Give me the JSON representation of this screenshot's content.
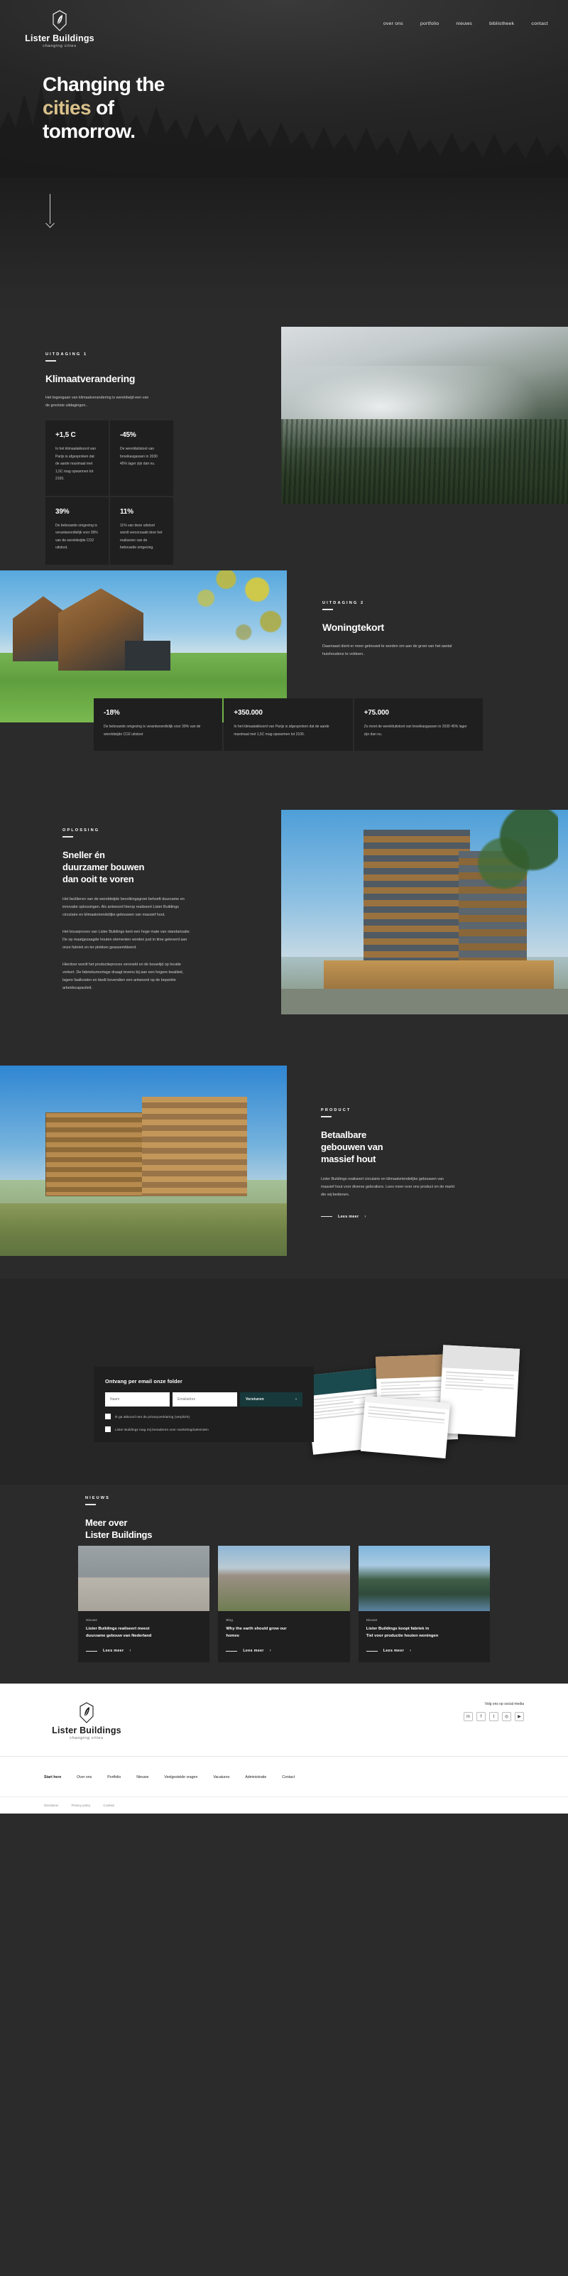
{
  "brand": {
    "name": "Lister Buildings",
    "tagline": "changing cities",
    "logo_icon": "leaf-shield-logo-icon"
  },
  "nav": {
    "items": [
      {
        "label": "over ons"
      },
      {
        "label": "portfolio"
      },
      {
        "label": "nieuws"
      },
      {
        "label": "bibliotheek"
      },
      {
        "label": "contact"
      }
    ]
  },
  "hero": {
    "line1": "Changing the",
    "line2_gold": "cities",
    "line2_rest": " of",
    "line3": "tomorrow.",
    "scroll_icon": "down-arrow-icon",
    "accent_color": "#d9c18a"
  },
  "section_climate": {
    "eyebrow": "UITDAGING 1",
    "title": "Klimaatverandering",
    "body": "Het tegengaan van klimaatverandering is wereldwijd een van de grootste uitdagingen..",
    "stats": [
      {
        "value": "+1,5 C",
        "text": "In het klimaatakkoord van Parijs is afgesproken dat de aarde maximaal met 1,5C mag opwarmen tot 2100."
      },
      {
        "value": "-45%",
        "text": "De werelduitstoot van broeikasgassen in 2030 45% lager zijn dan nu."
      },
      {
        "value": "39%",
        "text": "De bebouwde omgeving is verantwoordlelijk voor 39% van de wereldwijde CO2 uitstoot."
      },
      {
        "value": "11%",
        "text": "11% van deze uitstoot wordt veroorzaakt door het realiseren van de bebouwde omgeving."
      }
    ]
  },
  "section_housing": {
    "eyebrow": "UITDAGING 2",
    "title": "Woningtekort",
    "body": "Daarnaast dient er meer gebouwd te worden om aan de groei van het aantal huishoudens te voldoen..",
    "stats": [
      {
        "value": "-18%",
        "text": "De bebouwde omgeving is verantwoordlelijk voor 39% van de wereldwijde CO2 uitstoot"
      },
      {
        "value": "+350.000",
        "text": "In het klimaatakkoord van Parijs is afgesproken dat de aarde maximaal met 1,5C mag opwarmen tot 2100."
      },
      {
        "value": "+75.000",
        "text": "Zo moet de werelduitstoot van broeikasgassen in 2030 45% lager zijn dan nu."
      }
    ]
  },
  "section_solution": {
    "eyebrow": "OPLOSSING",
    "title_l1": "Sneller én",
    "title_l2": "duurzamer bouwen",
    "title_l3": "dan ooit te voren",
    "p1": "Het faciliteren van de wereldwijde bevolkingsgroei behoeft duurzame en innovatie oplossingen. Als antwoord hierop realiseert Lister Buildings circulaire en klimaatvriendelijke gebouwen van massief hout.",
    "p2": "Het bouwproces van Lister Buildings kent een hoge mate van standarisatie. De op maatgezaagde houten elementen worden just in time geleverd aan onze fabriek en ter plekken geassembleerd.",
    "p3": "Hierdoor wordt het productieproces versneld en de bouwtijd op locatie verkort. De fabrieksmontage draagt tevens bij aan een hogere kwaliteit, lagere faalkosten en biedt bovendien een antwoord op de beperkte arbeidscapaciteit."
  },
  "section_product": {
    "eyebrow": "PRODUCT",
    "title_l1": "Betaalbare",
    "title_l2": "gebouwen van",
    "title_l3": "massief hout",
    "body": "Lister Buildings realiseert circulaire en klimaatvriendelijke gebouwen van massief hout voor diverse gebruikers. Lees meer over ons product en de markt die wij bedienen.",
    "cta": "Lees meer",
    "cta_icon": "chevron-right-icon"
  },
  "newsletter": {
    "title": "Ontvang per email onze folder",
    "name_placeholder": "Naam",
    "email_placeholder": "Emailadres",
    "submit_label": "Versturen",
    "submit_icon": "chevron-right-icon",
    "submit_color": "#17393b",
    "checkbox1": "Ik ga akkoord met de privacyverklaring (verplicht)",
    "checkbox2": "Lister Buildings mag mij benaderen voor marketingdoeleinden"
  },
  "section_news": {
    "eyebrow": "NIEUWS",
    "title_l1": "Meer over",
    "title_l2": "Lister Buildings",
    "cta": "Lees meer",
    "cta_icon": "chevron-right-icon",
    "cards": [
      {
        "kicker": "Nieuws",
        "title_l1": "Lister Buildings realiseert meest",
        "title_l2": "duurzame gebouw van Nederland"
      },
      {
        "kicker": "Blog",
        "title_l1": "Why the earth should grow our",
        "title_l2": "homes"
      },
      {
        "kicker": "Nieuws",
        "title_l1": "Lister Buildings koopt fabriek in",
        "title_l2": "Tiel voor productie houten woningen"
      }
    ]
  },
  "footer": {
    "social_label": "Volg ons op social media",
    "social_icons": [
      {
        "name": "linkedin-icon",
        "glyph": "in"
      },
      {
        "name": "facebook-icon",
        "glyph": "f"
      },
      {
        "name": "twitter-icon",
        "glyph": "t"
      },
      {
        "name": "instagram-icon",
        "glyph": "◎"
      },
      {
        "name": "youtube-icon",
        "glyph": "▶"
      }
    ],
    "nav": [
      {
        "label": "Start here",
        "bold": true
      },
      {
        "label": "Over ons",
        "bold": false
      },
      {
        "label": "Portfolio",
        "bold": false
      },
      {
        "label": "Nieuws",
        "bold": false
      },
      {
        "label": "Veelgestelde vragen",
        "bold": false
      },
      {
        "label": "Vacatures",
        "bold": false
      },
      {
        "label": "Administratie",
        "bold": false
      },
      {
        "label": "Contact",
        "bold": false
      }
    ],
    "legal": [
      {
        "label": "Disclaimer"
      },
      {
        "label": "Privacy policy"
      },
      {
        "label": "Cookies"
      }
    ]
  }
}
